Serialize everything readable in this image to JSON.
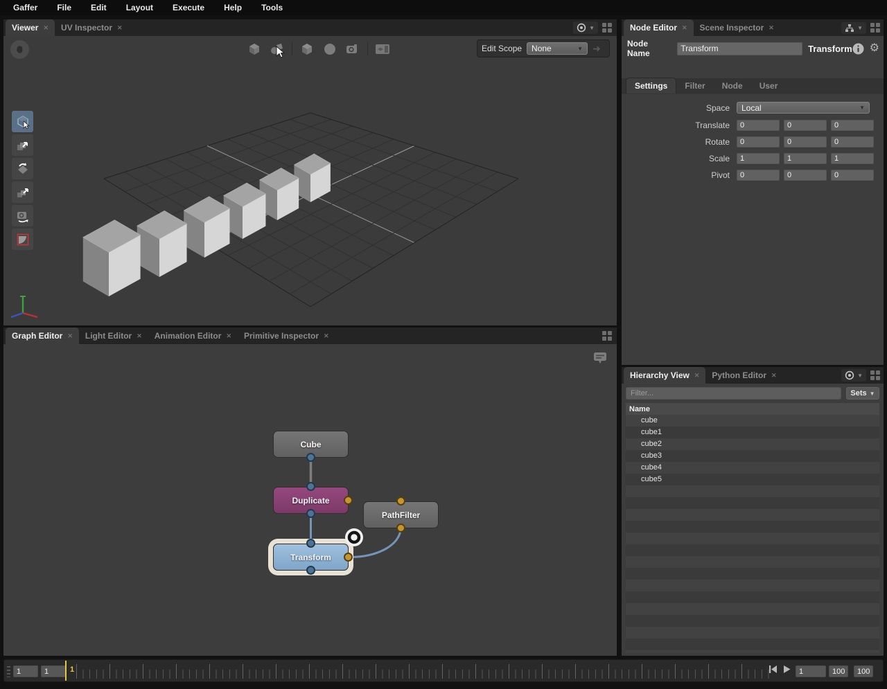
{
  "menu": {
    "items": [
      "Gaffer",
      "File",
      "Edit",
      "Layout",
      "Execute",
      "Help",
      "Tools"
    ]
  },
  "icons": {
    "close": "✕",
    "dropdown": "▼",
    "gear": "⚙"
  },
  "viewer": {
    "tabs": [
      {
        "label": "Viewer"
      },
      {
        "label": "UV Inspector"
      }
    ],
    "edit_scope": {
      "label": "Edit Scope",
      "value": "None"
    }
  },
  "graph_editor": {
    "tabs": [
      {
        "label": "Graph Editor"
      },
      {
        "label": "Light Editor"
      },
      {
        "label": "Animation Editor"
      },
      {
        "label": "Primitive Inspector"
      }
    ],
    "nodes": [
      {
        "label": "Cube"
      },
      {
        "label": "Duplicate"
      },
      {
        "label": "PathFilter"
      },
      {
        "label": "Transform"
      }
    ]
  },
  "node_editor": {
    "tabs": [
      {
        "label": "Node Editor"
      },
      {
        "label": "Scene Inspector"
      }
    ],
    "node_name_label": "Node Name",
    "node_name_value": "Transform",
    "node_type_label": "Transform",
    "sub_tabs": [
      {
        "label": "Settings"
      },
      {
        "label": "Filter"
      },
      {
        "label": "Node"
      },
      {
        "label": "User"
      }
    ],
    "form": {
      "space_label": "Space",
      "space_value": "Local",
      "translate_label": "Translate",
      "translate": [
        "0",
        "0",
        "0"
      ],
      "rotate_label": "Rotate",
      "rotate": [
        "0",
        "0",
        "0"
      ],
      "scale_label": "Scale",
      "scale": [
        "1",
        "1",
        "1"
      ],
      "pivot_label": "Pivot",
      "pivot": [
        "0",
        "0",
        "0"
      ]
    }
  },
  "hierarchy": {
    "tabs": [
      {
        "label": "Hierarchy View"
      },
      {
        "label": "Python Editor"
      }
    ],
    "filter_placeholder": "Filter...",
    "sets_label": "Sets",
    "column_header": "Name",
    "rows": [
      "cube",
      "cube1",
      "cube2",
      "cube3",
      "cube4",
      "cube5"
    ]
  },
  "timeline": {
    "left_fields": [
      "1",
      "1"
    ],
    "playhead_label": "1",
    "current_frame": "1",
    "range_end": "100",
    "range_end_2": "100"
  },
  "colors": {
    "accent_yellow": "#e8c841",
    "node_duplicate": "#8d4076",
    "node_transform": "#8fb3d8",
    "node_generic": "#6b6b6b",
    "selection_outline": "#e8e2d4",
    "connector_blue": "#4d7396",
    "connector_orange": "#c6952f"
  }
}
